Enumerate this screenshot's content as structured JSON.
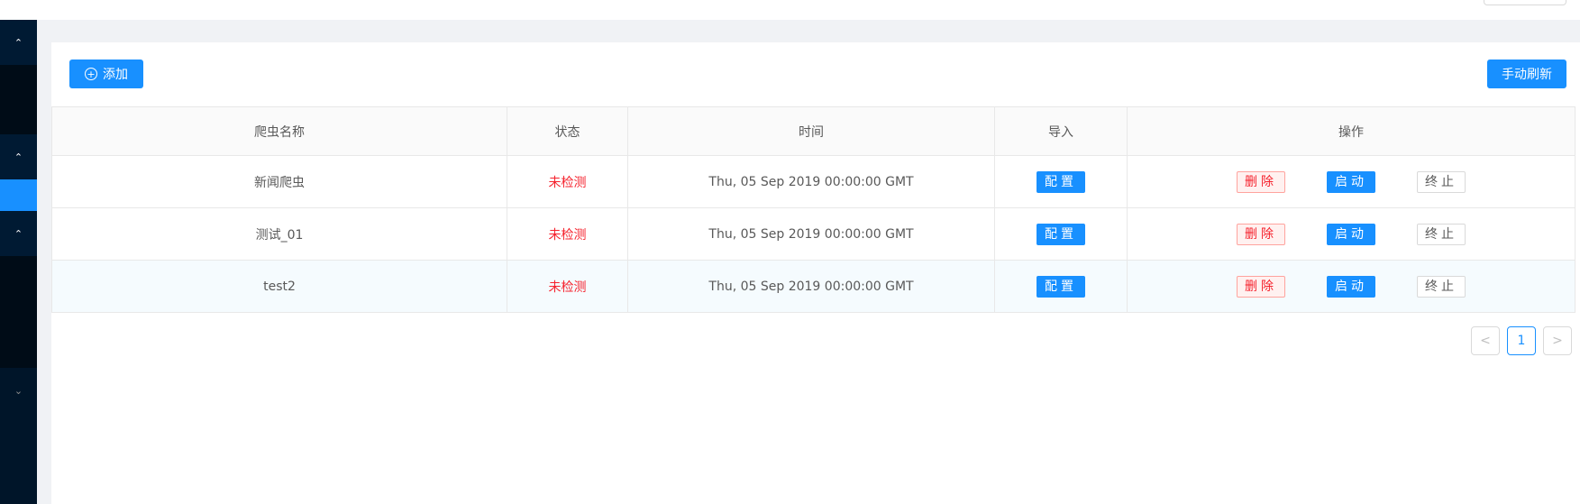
{
  "toolbar": {
    "add_label": "添加",
    "refresh_label": "手动刷新"
  },
  "table": {
    "headers": [
      "爬虫名称",
      "状态",
      "时间",
      "导入",
      "操作"
    ],
    "rows": [
      {
        "name": "新闻爬虫",
        "status": "未检测",
        "time": "Thu, 05 Sep 2019 00:00:00 GMT",
        "import": "配置",
        "delete": "删除",
        "start": "启动",
        "stop": "终止"
      },
      {
        "name": "测试_01",
        "status": "未检测",
        "time": "Thu, 05 Sep 2019 00:00:00 GMT",
        "import": "配置",
        "delete": "删除",
        "start": "启动",
        "stop": "终止"
      },
      {
        "name": "test2",
        "status": "未检测",
        "time": "Thu, 05 Sep 2019 00:00:00 GMT",
        "import": "配置",
        "delete": "删除",
        "start": "启动",
        "stop": "终止"
      }
    ]
  },
  "pagination": {
    "prev": "<",
    "current": "1",
    "next": ">"
  },
  "icons": {
    "sidebar": [
      "chevron-up-icon",
      "chevron-up-icon",
      "chevron-up-icon",
      "chevron-down-icon"
    ],
    "add": "plus-circle-icon"
  },
  "colors": {
    "primary": "#1890ff",
    "danger": "#f5222d",
    "sidebar": "#001529"
  }
}
